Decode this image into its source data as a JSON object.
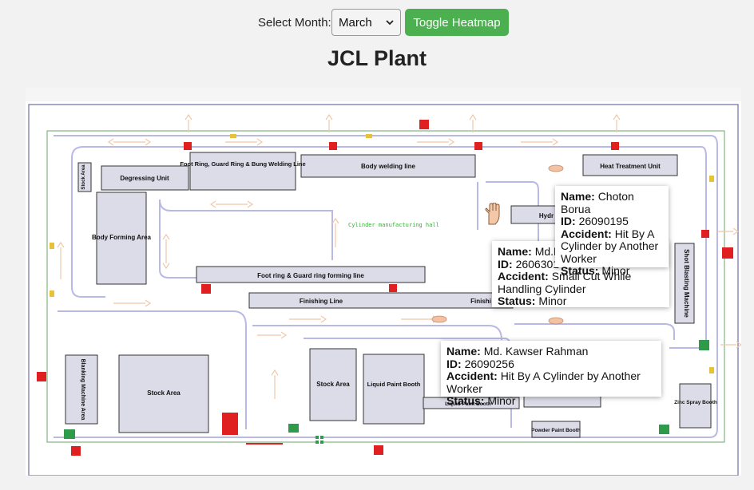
{
  "controls": {
    "month_label": "Select Month:",
    "month_selected": "March",
    "toggle_label": "Toggle Heatmap"
  },
  "title": "JCL Plant",
  "plan": {
    "areas": {
      "stock_area_small": "Stock Area",
      "degressing": "Degressing Unit",
      "foot_ring_bung": "Foot Ring, Guard Ring & Bung Welding Line",
      "body_welding": "Body welding line",
      "heat_treatment": "Heat Treatment Unit",
      "body_forming": "Body Forming Area",
      "cylinder_hall": "Cylinder manufacturing hall",
      "foot_guard_forming": "Foot ring & Guard ring forming line",
      "finishing": "Finishing Line",
      "finishing_right": "Finishi",
      "hydro": "Hydr",
      "shot_blasting": "Shot Blasting Machine",
      "blanking": "Blanking Machine Area",
      "stock_area_large": "Stock Area",
      "stock_area_mid": "Stock Area",
      "liquid_paint": "Liquid Paint Booth",
      "liquid_paint_label": "Liquid Paint Booth",
      "powder_paint": "Powder Paint Booth",
      "zinc_spray": "Zinc Spray Booth"
    }
  },
  "tooltips": [
    {
      "name_label": "Name:",
      "name": "Choton Borua",
      "id_label": "ID:",
      "id": "26090195",
      "accident_label": "Accident:",
      "accident": "Hit By A Cylinder by Another Worker",
      "status_label": "Status:",
      "status": "Minor"
    },
    {
      "name_label": "Name:",
      "name": "Md.R",
      "id_label": "ID:",
      "id": "2606301",
      "accident_label": "Accident:",
      "accident": "Small Cut While Handling Cylinder",
      "status_label": "Status:",
      "status": "Minor"
    },
    {
      "name_label": "Name:",
      "name": "Md. Kawser Rahman",
      "id_label": "ID:",
      "id": "26090256",
      "accident_label": "Accident:",
      "accident": "Hit By A Cylinder by Another Worker",
      "status_label": "Status:",
      "status": "Minor"
    }
  ],
  "icons": [
    "chevron-down-icon",
    "hand-icon",
    "foot-icon",
    "fire-extinguisher-icon",
    "emergency-exit-icon",
    "first-aid-icon"
  ],
  "colors": {
    "button": "#4caf50",
    "area_fill": "#dcdbe8",
    "walkway": "#b9b9e6",
    "exit": "#2e9a4a",
    "fire": "#e02020"
  }
}
